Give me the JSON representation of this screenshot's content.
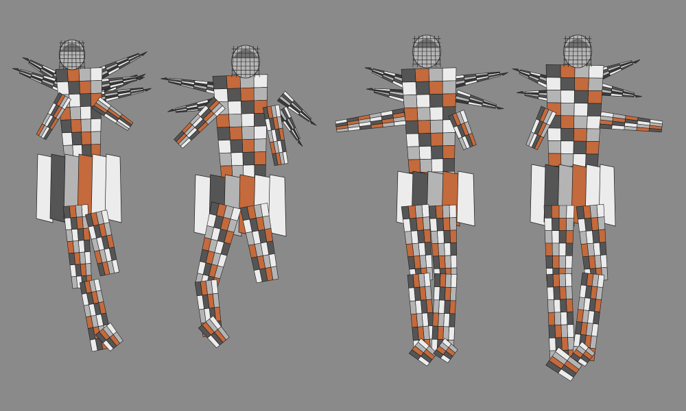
{
  "scene": {
    "background_color": "#8a8a8a",
    "palette": {
      "copper": "#c46a3c",
      "copper_dark": "#8a4424",
      "light": "#ececec",
      "mid": "#b4b4b4",
      "shadow": "#555555",
      "dark": "#3a3a3a",
      "wire": "#1a1a1a"
    },
    "figures": [
      {
        "pose": "back-view-leaning-right"
      },
      {
        "pose": "front-three-quarter-crouching"
      },
      {
        "pose": "front-view-arms-outstretched"
      },
      {
        "pose": "back-view-arm-outstretched"
      }
    ]
  }
}
